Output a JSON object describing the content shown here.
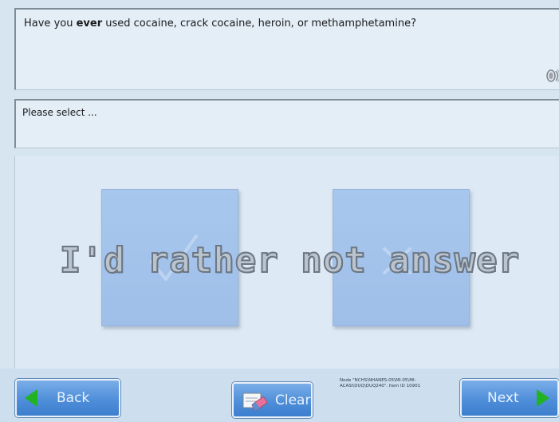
{
  "question": {
    "prefix": "Have you ",
    "emphasis": "ever",
    "suffix": " used cocaine, crack cocaine, heroin, or methamphetamine?"
  },
  "prompt": {
    "text": "Please select ..."
  },
  "choices": [
    {
      "id": "yes",
      "icon": "checkmark-icon"
    },
    {
      "id": "no",
      "icon": "x-mark-icon"
    }
  ],
  "refuse_label": "I'd rather not answer",
  "footer": {
    "back_label": "Back",
    "clear_label": "Clear",
    "next_label": "Next",
    "node_info": "Node \"NCHS\\NHANES-05\\MI-05\\MI-ACASI\\DUQ\\DUQ240\". Item ID 10901"
  },
  "colors": {
    "accent_green": "#22b322",
    "button_blue": "#4c8cd8",
    "choice_blue": "#a7c7ee"
  }
}
